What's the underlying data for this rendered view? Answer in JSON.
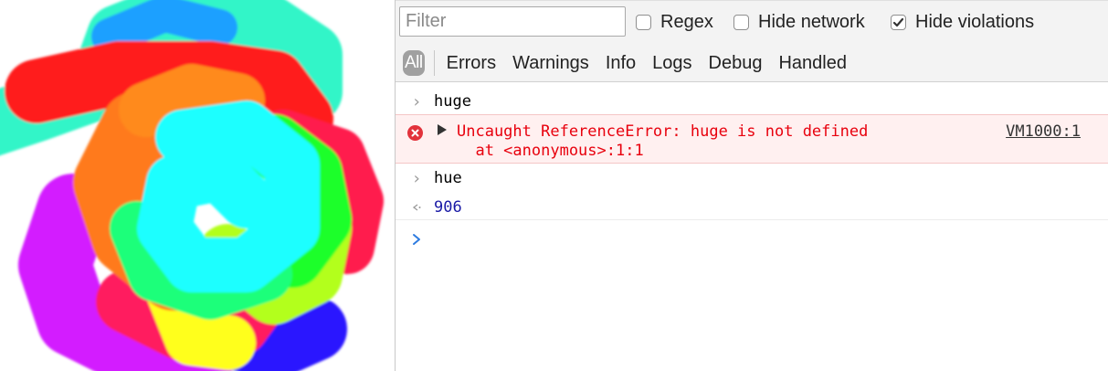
{
  "console": {
    "filter": {
      "value": "",
      "placeholder": "Filter"
    },
    "toggles": [
      {
        "label": "Regex",
        "checked": false
      },
      {
        "label": "Hide network",
        "checked": false
      },
      {
        "label": "Hide violations",
        "checked": true
      }
    ],
    "levels": [
      "All",
      "Errors",
      "Warnings",
      "Info",
      "Logs",
      "Debug",
      "Handled"
    ],
    "selected_level": "All",
    "messages": [
      {
        "type": "input",
        "text": "huge"
      },
      {
        "type": "error",
        "text": "Uncaught ReferenceError: huge is not defined",
        "stack": "  at <anonymous>:1:1",
        "source": "VM1000:1"
      },
      {
        "type": "input",
        "text": "hue"
      },
      {
        "type": "result",
        "text": "906"
      },
      {
        "type": "prompt",
        "text": ""
      }
    ]
  },
  "colors": {
    "error_text": "#e8000d",
    "error_background": "#fff0f0",
    "result_number": "#1a1aa6",
    "prompt_arrow": "#2d7be0"
  }
}
